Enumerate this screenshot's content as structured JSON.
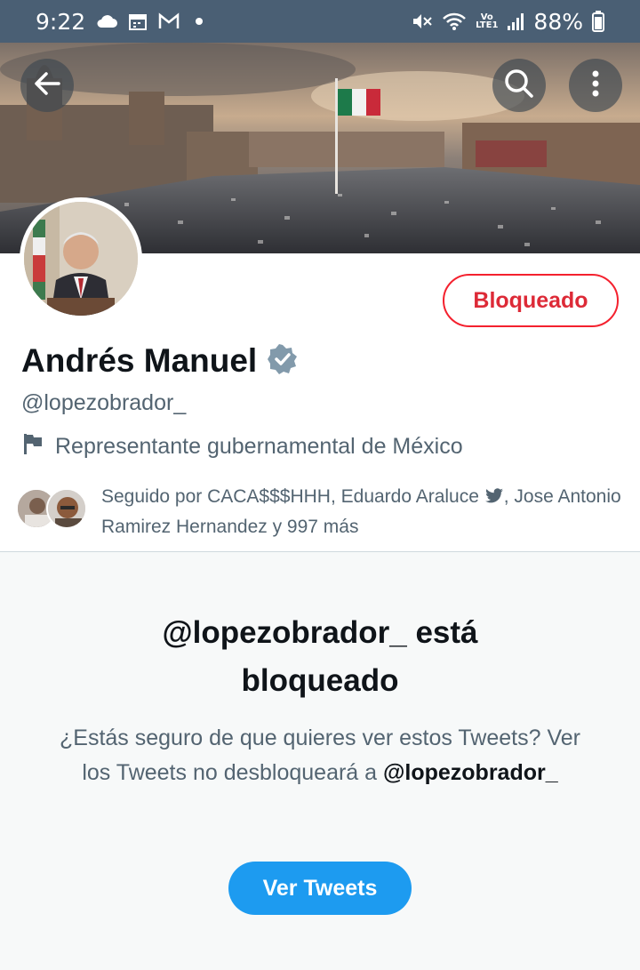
{
  "status_bar": {
    "time": "9:22",
    "battery": "88%",
    "volte_top": "Vo",
    "volte_bottom": "LTE1"
  },
  "header": {
    "back_icon": "arrow-left-icon",
    "search_icon": "search-icon",
    "more_icon": "more-vertical-icon"
  },
  "profile": {
    "name": "Andrés Manuel",
    "handle": "@lopezobrador_",
    "bio_icon": "flag-icon",
    "bio": "Representante gubernamental de México",
    "blocked_button": "Bloqueado",
    "followed_by_prefix": "Seguido por CACA$$$HHH, Eduardo Araluce",
    "followed_by_suffix": ", Jose Antonio Ramirez Hernandez y 997 más"
  },
  "blocked_notice": {
    "title_line1": "@lopezobrador_ está",
    "title_line2": "bloqueado",
    "desc": "¿Estás seguro de que quieres ver estos Tweets? Ver los Tweets no desbloqueará a ",
    "desc_handle": "@lopezobrador_",
    "view_button": "Ver Tweets"
  },
  "colors": {
    "blocked_red": "#f4212e",
    "accent_blue": "#1d9bf0",
    "verified_gray": "#829aab"
  }
}
